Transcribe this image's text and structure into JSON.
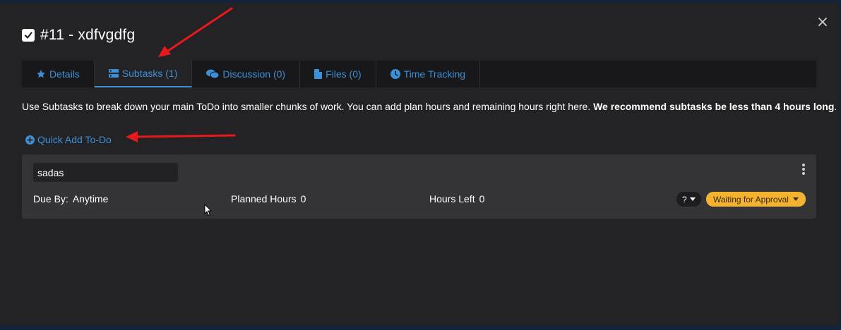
{
  "modal": {
    "title": "#11 - xdfvgdfg",
    "close_label": "×"
  },
  "tabs": [
    {
      "label": "Details",
      "icon": "star-icon"
    },
    {
      "label": "Subtasks (1)",
      "icon": "tasks-icon",
      "active": true
    },
    {
      "label": "Discussion (0)",
      "icon": "comments-icon"
    },
    {
      "label": "Files (0)",
      "icon": "file-icon"
    },
    {
      "label": "Time Tracking",
      "icon": "clock-icon"
    }
  ],
  "description": {
    "text": "Use Subtasks to break down your main ToDo into smaller chunks of work. You can add plan hours and remaining hours right here. ",
    "emphasis": "We recommend subtasks be less than 4 hours long",
    "tail": "."
  },
  "quick_add": {
    "label": "Quick Add To-Do"
  },
  "subtask": {
    "name": "sadas",
    "due_label": "Due By:",
    "due_value": "Anytime",
    "planned_label": "Planned Hours",
    "planned_value": "0",
    "left_label": "Hours Left",
    "left_value": "0",
    "assignee_label": "?",
    "status_label": "Waiting for Approval"
  },
  "colors": {
    "accent": "#3d8fd6",
    "status": "#f3b331",
    "annotation": "#e8191c"
  }
}
